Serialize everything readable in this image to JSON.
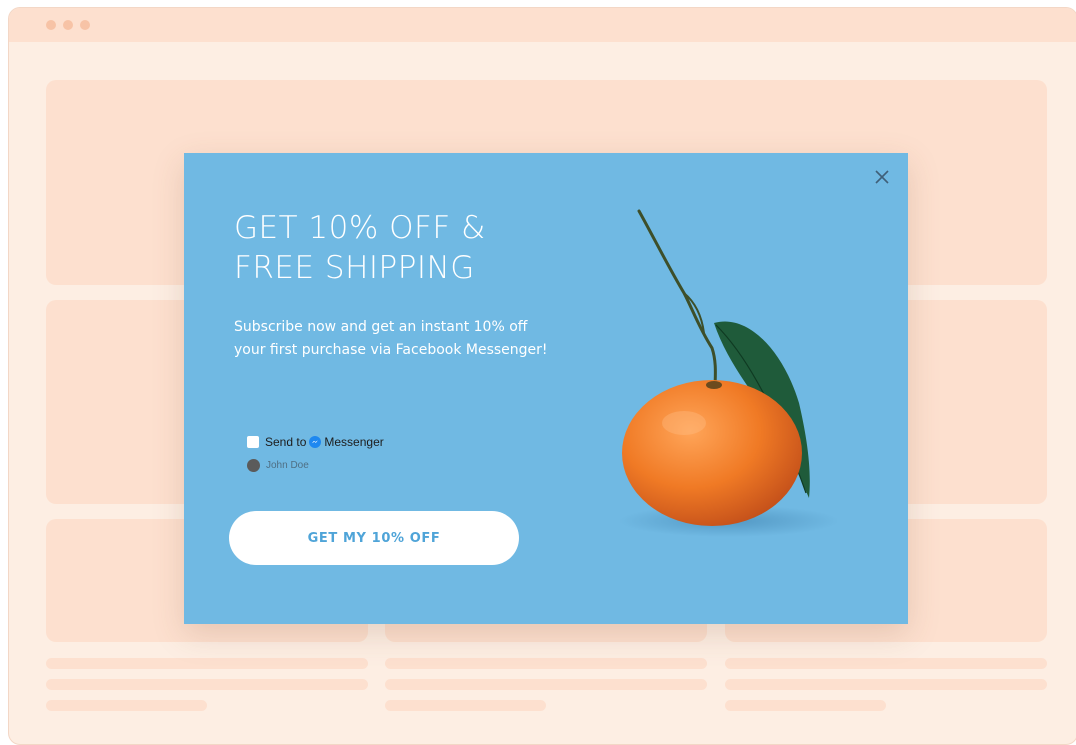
{
  "browser": {
    "dots": [
      "dot-1",
      "dot-2",
      "dot-3"
    ]
  },
  "popup": {
    "headline_line1": "GET 10% OFF &",
    "headline_line2": "FREE SHIPPING",
    "subtext": "Subscribe now and get an instant 10% off your first purchase via Facebook Messenger!",
    "optin": {
      "send_to": "Send to",
      "messenger": "Messenger",
      "user_name": "John Doe",
      "checked": false
    },
    "cta_label": "GET MY 10% OFF",
    "close_icon": "close-icon",
    "image": "orange-with-leaf"
  },
  "colors": {
    "popup_bg": "#70b9e3",
    "page_bg": "#fdeee3",
    "placeholder": "#fde0cf",
    "cta_text": "#4fa4d8",
    "orange": "#f07a25"
  }
}
